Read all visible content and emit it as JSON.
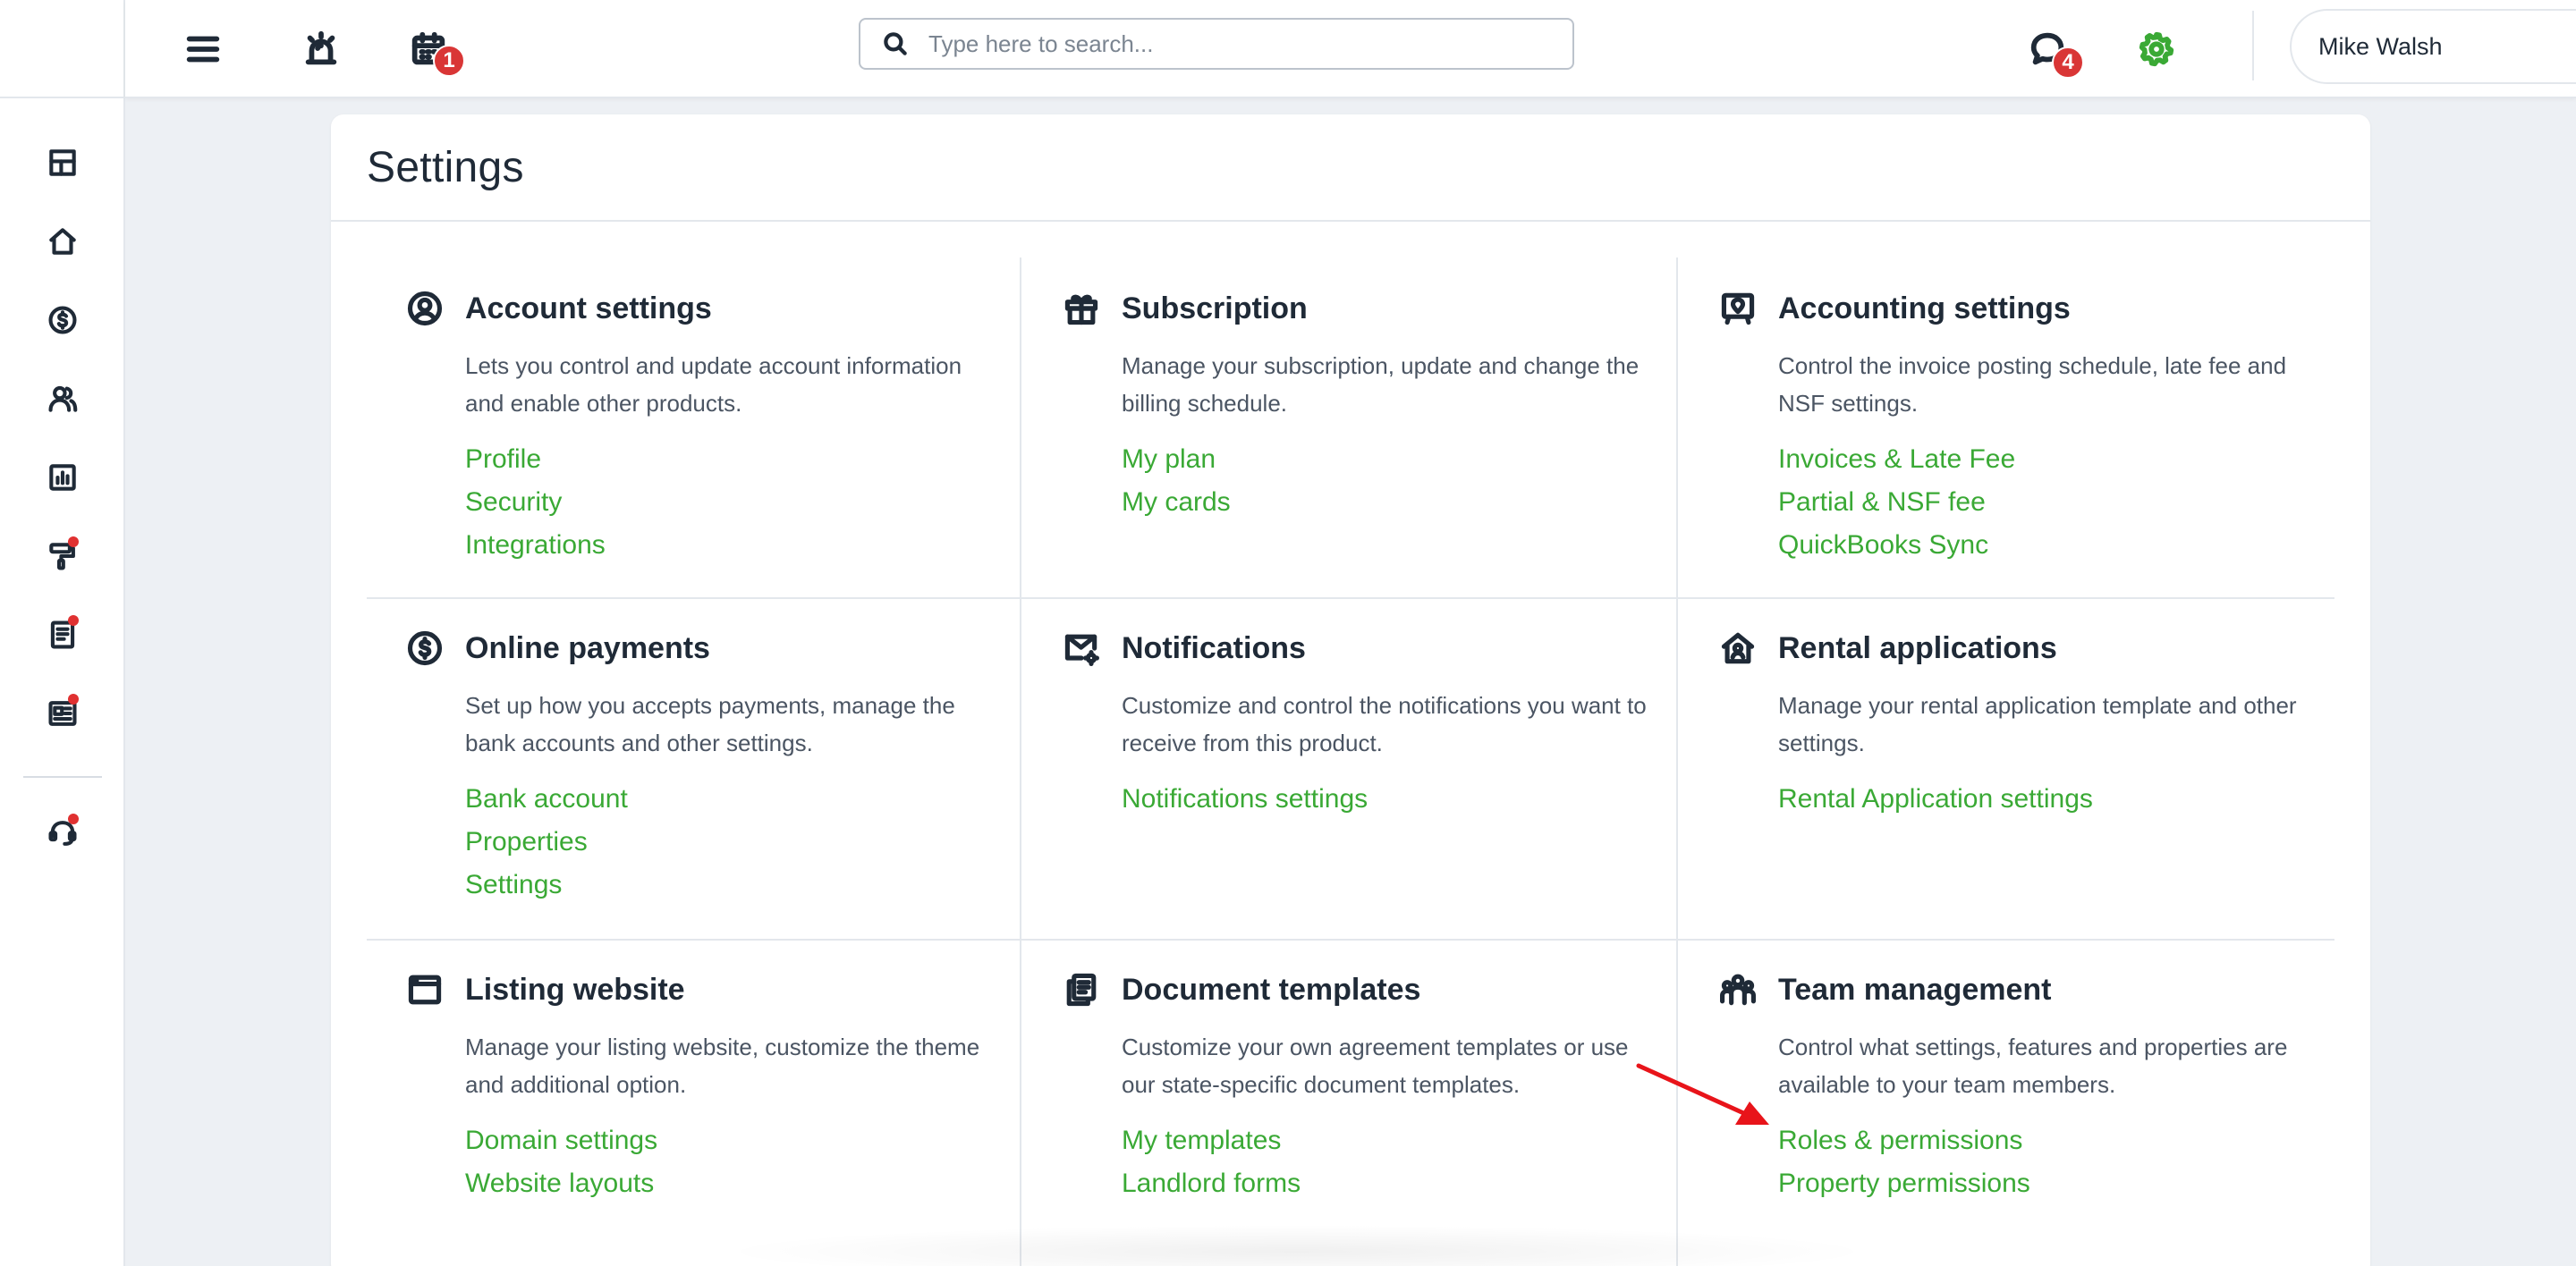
{
  "topbar": {
    "search_placeholder": "Type here to search...",
    "calendar_badge": "1",
    "messages_badge": "4",
    "user_name": "Mike Walsh"
  },
  "sidebar": {
    "items": [
      {
        "icon": "dashboard-icon",
        "dot": false
      },
      {
        "icon": "home-icon",
        "dot": false
      },
      {
        "icon": "dollar-icon",
        "dot": false
      },
      {
        "icon": "people-icon",
        "dot": false
      },
      {
        "icon": "reports-icon",
        "dot": false
      },
      {
        "icon": "maintenance-icon",
        "dot": true
      },
      {
        "icon": "document-icon",
        "dot": true
      },
      {
        "icon": "listing-icon",
        "dot": true
      },
      {
        "icon": "support-icon",
        "dot": true
      }
    ]
  },
  "page": {
    "title": "Settings"
  },
  "sections": [
    {
      "title": "Account settings",
      "icon": "user-circle-icon",
      "description": "Lets you control and update account information and enable other products.",
      "links": [
        "Profile",
        "Security",
        "Integrations"
      ]
    },
    {
      "title": "Subscription",
      "icon": "gift-icon",
      "description": "Manage your subscription, update and change the billing schedule.",
      "links": [
        "My plan",
        "My cards"
      ]
    },
    {
      "title": "Accounting settings",
      "icon": "accounting-icon",
      "description": "Control the invoice posting schedule, late fee and NSF settings.",
      "links": [
        "Invoices & Late Fee",
        "Partial & NSF fee",
        "QuickBooks Sync"
      ]
    },
    {
      "title": "Online payments",
      "icon": "dollar-circle-icon",
      "description": "Set up how you accepts payments, manage the bank accounts and other settings.",
      "links": [
        "Bank account",
        "Properties",
        "Settings"
      ]
    },
    {
      "title": "Notifications",
      "icon": "mail-gear-icon",
      "description": "Customize and control the notifications you want to receive from this product.",
      "links": [
        "Notifications settings"
      ]
    },
    {
      "title": "Rental applications",
      "icon": "house-user-icon",
      "description": "Manage your rental application template and other settings.",
      "links": [
        "Rental Application settings"
      ]
    },
    {
      "title": "Listing website",
      "icon": "browser-window-icon",
      "description": "Manage your listing website, customize the theme and additional option.",
      "links": [
        "Domain settings",
        "Website layouts"
      ]
    },
    {
      "title": "Document templates",
      "icon": "documents-icon",
      "description": "Customize your own agreement templates or use our state-specific document templates.",
      "links": [
        "My templates",
        "Landlord forms"
      ]
    },
    {
      "title": "Team management",
      "icon": "team-icon",
      "description": "Control what settings, features and properties are available to your team members.",
      "links": [
        "Roles & permissions",
        "Property permissions"
      ]
    }
  ],
  "colors": {
    "link": "#3aa935",
    "badge": "#d93636",
    "arrow": "#e8141a"
  }
}
